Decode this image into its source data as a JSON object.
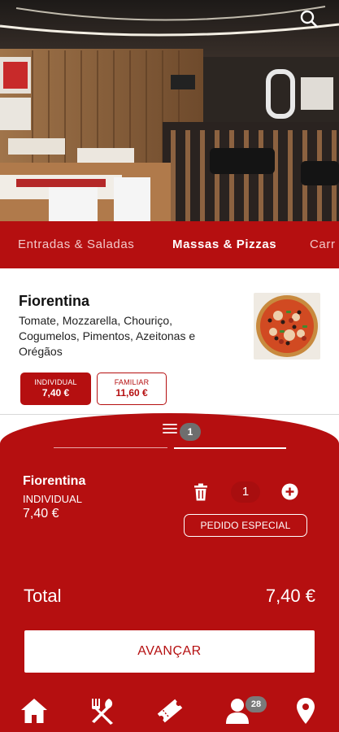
{
  "header": {
    "search_icon": "search-icon"
  },
  "categories": [
    {
      "label": "Entradas & Saladas",
      "active": false
    },
    {
      "label": "Massas & Pizzas",
      "active": true
    },
    {
      "label": "Carr",
      "active": false
    }
  ],
  "product": {
    "name": "Fiorentina",
    "description": "Tomate, Mozzarella, Chouriço, Cogumelos, Pimentos, Azeitonas e Orégãos",
    "sizes": [
      {
        "label": "INDIVIDUAL",
        "price": "7,40 €",
        "selected": true
      },
      {
        "label": "FAMILIAR",
        "price": "11,60 €",
        "selected": false
      }
    ]
  },
  "cart": {
    "count": "1",
    "item": {
      "name": "Fiorentina",
      "size": "INDIVIDUAL",
      "price": "7,40 €",
      "quantity": "1"
    },
    "special_order_label": "PEDIDO ESPECIAL",
    "total_label": "Total",
    "total_value": "7,40 €",
    "advance_label": "AVANÇAR"
  },
  "nav": {
    "items": [
      "home-icon",
      "menu-icon",
      "ticket-icon",
      "profile-icon",
      "location-icon"
    ],
    "profile_badge": "28"
  },
  "colors": {
    "brand_red": "#b50f10",
    "white": "#ffffff"
  }
}
